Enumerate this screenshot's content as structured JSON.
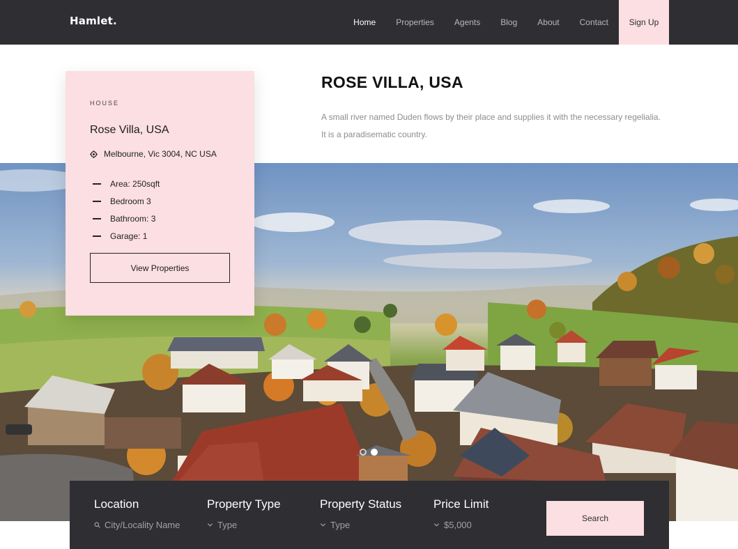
{
  "brand": "Hamlet.",
  "nav": {
    "items": [
      "Home",
      "Properties",
      "Agents",
      "Blog",
      "About",
      "Contact"
    ],
    "active": "Home",
    "signup": "Sign Up"
  },
  "card": {
    "kicker": "HOUSE",
    "title": "Rose Villa, USA",
    "address": "Melbourne, Vic 3004, NC USA",
    "address_icon": "location-pin-icon",
    "specs": [
      "Area: 250sqft",
      "Bedroom 3",
      "Bathroom: 3",
      "Garage: 1"
    ],
    "button": "View Properties"
  },
  "intro": {
    "heading": "ROSE VILLA, USA",
    "description": "A small river named Duden flows by their place and supplies it with the necessary regelialia. It is a paradisematic country."
  },
  "search": {
    "fields": [
      {
        "label": "Location",
        "placeholder": "City/Locality Name",
        "icon": "search-icon"
      },
      {
        "label": "Property Type",
        "placeholder": "Type",
        "icon": "chevron-down-icon"
      },
      {
        "label": "Property Status",
        "placeholder": "Type",
        "icon": "chevron-down-icon"
      },
      {
        "label": "Price Limit",
        "placeholder": "$5,000",
        "icon": "chevron-down-icon"
      }
    ],
    "button": "Search"
  },
  "colors": {
    "dark": "#2e2e33",
    "accent_pink": "#fcdfe2",
    "muted_text": "#8c8c8c"
  }
}
